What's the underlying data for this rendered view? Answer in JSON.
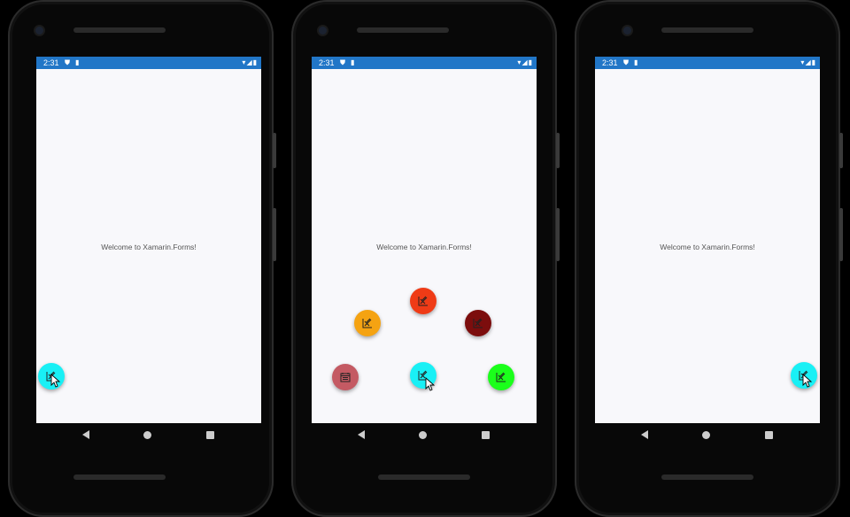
{
  "phones": [
    {
      "status_time": "2:31",
      "welcome_text": "Welcome to Xamarin.Forms!"
    },
    {
      "status_time": "2:31",
      "welcome_text": "Welcome to Xamarin.Forms!"
    },
    {
      "status_time": "2:31",
      "welcome_text": "Welcome to Xamarin.Forms!"
    }
  ],
  "colors": {
    "status_bar": "#2176c7",
    "screen_bg": "#f8f8fb",
    "fab_cyan": "#19f0f5",
    "fab_red": "#ef3b16",
    "fab_orange": "#f5a312",
    "fab_maroon": "#7c0d0d",
    "fab_rose": "#c45a63",
    "fab_green": "#1bff1b"
  },
  "icons": {
    "fab_icon": "draw-pen-icon",
    "fab_rose_icon": "calendar-icon",
    "status_left": [
      "shield-icon",
      "sim-card-icon"
    ],
    "status_right": [
      "wifi-icon",
      "signal-icon",
      "battery-icon"
    ],
    "nav": [
      "back-icon",
      "home-icon",
      "recents-icon"
    ]
  }
}
